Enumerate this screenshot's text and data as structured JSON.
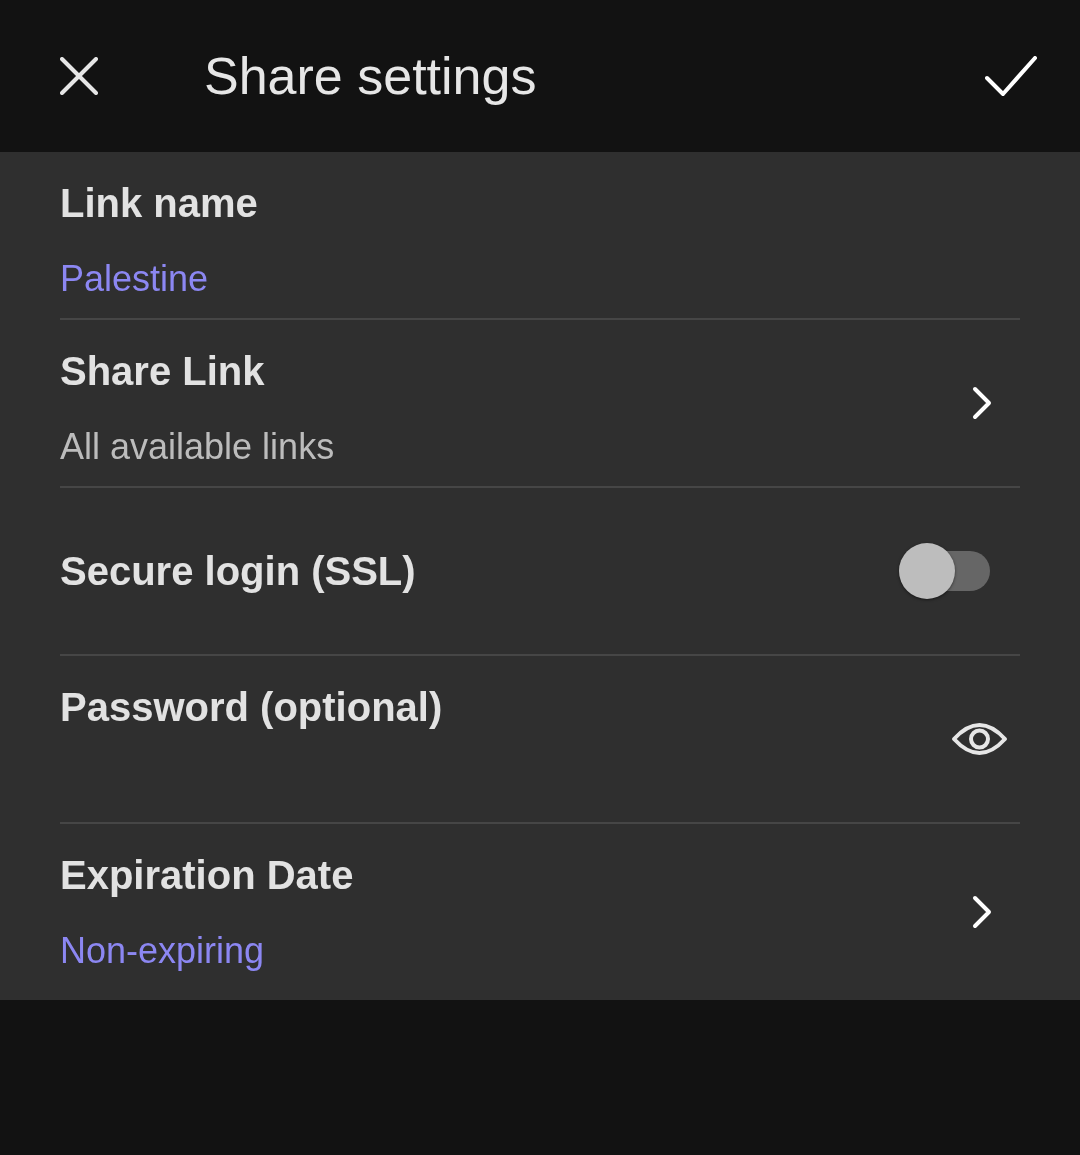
{
  "toolbar": {
    "title": "Share settings"
  },
  "settings": [
    {
      "kind": "value",
      "label": "Link name",
      "value": "Palestine",
      "accent": true
    },
    {
      "kind": "link",
      "label": "Share Link",
      "value": "All available links",
      "accent": false
    },
    {
      "kind": "switch",
      "label": "Secure login (SSL)",
      "on": false
    },
    {
      "kind": "password",
      "label": "Password (optional)"
    },
    {
      "kind": "link",
      "label": "Expiration Date",
      "value": "Non-expiring",
      "accent": true
    }
  ]
}
